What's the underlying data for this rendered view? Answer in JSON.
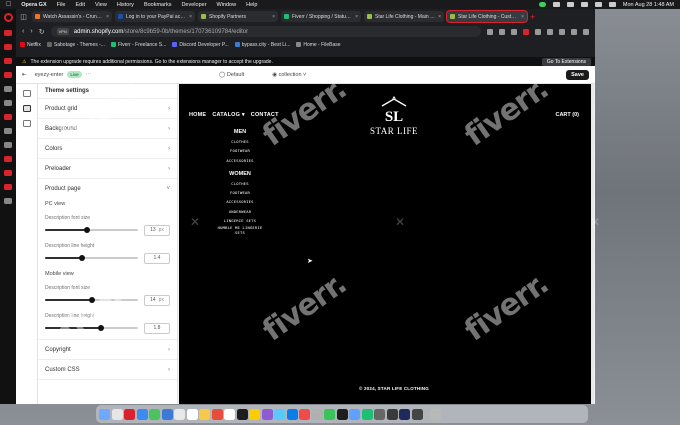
{
  "menubar": {
    "app": "Opera GX",
    "menus": [
      "File",
      "Edit",
      "View",
      "History",
      "Bookmarks",
      "Developer",
      "Window",
      "Help"
    ],
    "clock": "Mon Aug 28  1:48 AM"
  },
  "tabs": [
    {
      "title": "Watch Assassin's - Crunchyroll",
      "color": "#f47521",
      "active": false
    },
    {
      "title": "Log in to your PayPal account",
      "color": "#1b4fa8",
      "active": false
    },
    {
      "title": "Shopify Partners",
      "color": "#95bf47",
      "active": false
    },
    {
      "title": "Fiverr / Shopping / Status of yo",
      "color": "#1dbf73",
      "active": false
    },
    {
      "title": "Star Life Clothing - Main menu",
      "color": "#95bf47",
      "active": false
    },
    {
      "title": "Star Life Clothing - Customize",
      "color": "#95bf47",
      "active": true
    }
  ],
  "address": {
    "vpn": "VPN",
    "host": "admin.shopify.com",
    "path": "/store/8c9b59-0b/themes/170736109784/editor"
  },
  "bookmarks": [
    {
      "label": "Netflix",
      "color": "#e50914"
    },
    {
      "label": "Sabotage - Themes -...",
      "color": "#666666"
    },
    {
      "label": "Fiverr - Freelance S...",
      "color": "#1dbf73"
    },
    {
      "label": "Discord Developer P...",
      "color": "#5865f2"
    },
    {
      "label": "bypass.city - Best Li...",
      "color": "#3a7bd5"
    },
    {
      "label": "Home - FileBase",
      "color": "#888888"
    }
  ],
  "warning": {
    "text": "The extension upgrade requires additional permissions. Go to the extensions manager to accept the upgrade.",
    "button": "Go To Extensions"
  },
  "editor_top": {
    "theme_name": "eyezy-enter",
    "status": "Live",
    "template": "Default",
    "collection": "collection",
    "save_label": "Save"
  },
  "settings": {
    "sections_top": [
      "Theme settings",
      "Product grid",
      "Background",
      "Colors",
      "Preloader"
    ],
    "product_page": {
      "title": "Product page",
      "pc_view": "PC view",
      "pc_font_size_label": "Description font size",
      "pc_font_size_value": "13",
      "pc_font_size_unit": "px",
      "pc_font_size_level": 0.45,
      "pc_line_height_label": "Description line height",
      "pc_line_height_value": "1.4",
      "pc_line_height_level": 0.4,
      "mobile_view": "Mobile view",
      "mob_font_size_label": "Description font size",
      "mob_font_size_value": "14",
      "mob_font_size_unit": "px",
      "mob_font_size_level": 0.5,
      "mob_line_height_label": "Description line height",
      "mob_line_height_value": "1.8",
      "mob_line_height_level": 0.6
    },
    "sections_bottom": [
      "Copyright",
      "Custom CSS"
    ]
  },
  "site": {
    "nav": [
      "HOME",
      "CATALOG ▾",
      "CONTACT"
    ],
    "cart": "CART (0)",
    "brand": "STAR LIFE",
    "logo_letters": "SL",
    "men_heading": "MEN",
    "men_items": [
      "CLOTHES",
      "FOOTWEAR",
      "ACCESSORIES"
    ],
    "women_heading": "WOMEN",
    "women_items": [
      "CLOTHES",
      "FOOTWEAR",
      "ACCESSORIES",
      "UNDERWEAR",
      "LINGERIE SETS"
    ],
    "women_two_line": "HUMBLE ME LINGERIE SETS",
    "footer": "© 2024, STAR LIFE CLOTHING"
  },
  "watermark": "fiverr.",
  "dock_colors": [
    "#6ea8ff",
    "#e6e6e6",
    "#d8232f",
    "#3b8cf0",
    "#4bc35f",
    "#3a7bd5",
    "#e8e8e8",
    "#ffffff",
    "#f7c948",
    "#e84c3d",
    "#ffffff",
    "#1d1d1f",
    "#ffcc00",
    "#8e5bd1",
    "#5ac8fa",
    "#0c7ce6",
    "#f04a4a",
    "#b0b0b0",
    "#3ac35a",
    "#1e1e1e",
    "#60a0ff",
    "#1dbf73",
    "#666666",
    "#3a3a3a",
    "#1f2a5c",
    "#444444",
    "#b8b8b8"
  ]
}
